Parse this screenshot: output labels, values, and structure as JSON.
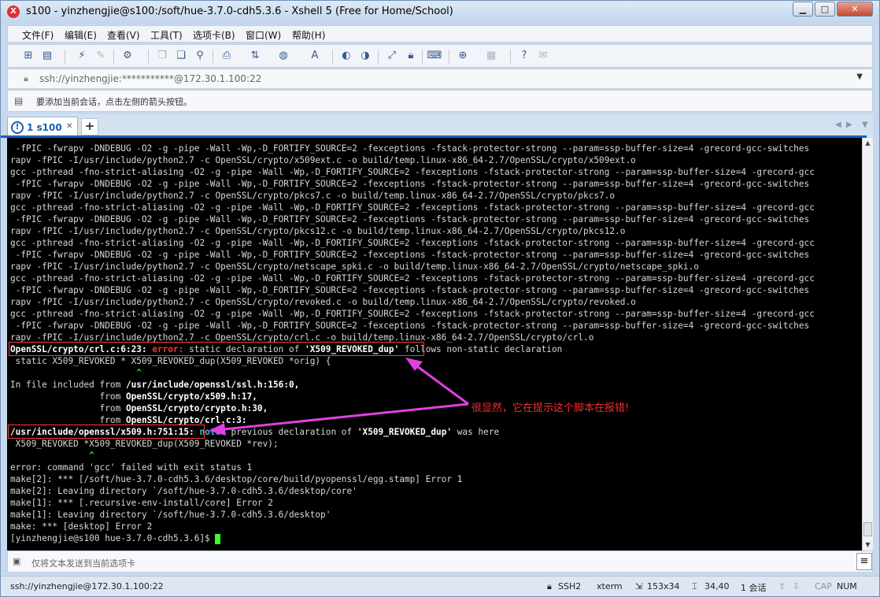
{
  "window": {
    "title": "s100 - yinzhengjie@s100:/soft/hue-3.7.0-cdh5.3.6 - Xshell 5 (Free for Home/School)",
    "app_icon": "xshell-icon",
    "minimize_icon": "minimize-icon",
    "maximize_icon": "maximize-icon",
    "close_icon": "close-icon"
  },
  "menu": [
    "文件(F)",
    "编辑(E)",
    "查看(V)",
    "工具(T)",
    "选项卡(B)",
    "窗口(W)",
    "帮助(H)"
  ],
  "toolbar_icons": [
    "new-session-icon",
    "open-folder-icon",
    "connect-icon",
    "disconnect-icon",
    "properties-icon",
    "copy-icon",
    "paste-icon",
    "find-icon",
    "print-icon",
    "transfer-icon",
    "globe-icon",
    "font-icon",
    "xftp-icon",
    "xmanager-icon",
    "fullscreen-icon",
    "lock-icon",
    "keyboard-icon",
    "compose-icon",
    "layout-icon",
    "help-icon",
    "chat-icon"
  ],
  "address": {
    "value": "ssh://yinzhengjie:***********@172.30.1.100:22"
  },
  "hint": {
    "text": "要添加当前会话，点击左侧的箭头按钮。"
  },
  "tabs": [
    {
      "label": "1 s100",
      "status": "alert-icon"
    }
  ],
  "tab_add": "+",
  "terminal": {
    "lines": [
      " -fPIC -fwrapv -DNDEBUG -O2 -g -pipe -Wall -Wp,-D_FORTIFY_SOURCE=2 -fexceptions -fstack-protector-strong --param=ssp-buffer-size=4 -grecord-gcc-switches",
      "rapv -fPIC -I/usr/include/python2.7 -c OpenSSL/crypto/x509ext.c -o build/temp.linux-x86_64-2.7/OpenSSL/crypto/x509ext.o",
      "gcc -pthread -fno-strict-aliasing -O2 -g -pipe -Wall -Wp,-D_FORTIFY_SOURCE=2 -fexceptions -fstack-protector-strong --param=ssp-buffer-size=4 -grecord-gcc",
      " -fPIC -fwrapv -DNDEBUG -O2 -g -pipe -Wall -Wp,-D_FORTIFY_SOURCE=2 -fexceptions -fstack-protector-strong --param=ssp-buffer-size=4 -grecord-gcc-switches",
      "rapv -fPIC -I/usr/include/python2.7 -c OpenSSL/crypto/pkcs7.c -o build/temp.linux-x86_64-2.7/OpenSSL/crypto/pkcs7.o",
      "gcc -pthread -fno-strict-aliasing -O2 -g -pipe -Wall -Wp,-D_FORTIFY_SOURCE=2 -fexceptions -fstack-protector-strong --param=ssp-buffer-size=4 -grecord-gcc",
      " -fPIC -fwrapv -DNDEBUG -O2 -g -pipe -Wall -Wp,-D_FORTIFY_SOURCE=2 -fexceptions -fstack-protector-strong --param=ssp-buffer-size=4 -grecord-gcc-switches",
      "rapv -fPIC -I/usr/include/python2.7 -c OpenSSL/crypto/pkcs12.c -o build/temp.linux-x86_64-2.7/OpenSSL/crypto/pkcs12.o",
      "gcc -pthread -fno-strict-aliasing -O2 -g -pipe -Wall -Wp,-D_FORTIFY_SOURCE=2 -fexceptions -fstack-protector-strong --param=ssp-buffer-size=4 -grecord-gcc",
      " -fPIC -fwrapv -DNDEBUG -O2 -g -pipe -Wall -Wp,-D_FORTIFY_SOURCE=2 -fexceptions -fstack-protector-strong --param=ssp-buffer-size=4 -grecord-gcc-switches",
      "rapv -fPIC -I/usr/include/python2.7 -c OpenSSL/crypto/netscape_spki.c -o build/temp.linux-x86_64-2.7/OpenSSL/crypto/netscape_spki.o",
      "gcc -pthread -fno-strict-aliasing -O2 -g -pipe -Wall -Wp,-D_FORTIFY_SOURCE=2 -fexceptions -fstack-protector-strong --param=ssp-buffer-size=4 -grecord-gcc",
      " -fPIC -fwrapv -DNDEBUG -O2 -g -pipe -Wall -Wp,-D_FORTIFY_SOURCE=2 -fexceptions -fstack-protector-strong --param=ssp-buffer-size=4 -grecord-gcc-switches",
      "rapv -fPIC -I/usr/include/python2.7 -c OpenSSL/crypto/revoked.c -o build/temp.linux-x86_64-2.7/OpenSSL/crypto/revoked.o",
      "gcc -pthread -fno-strict-aliasing -O2 -g -pipe -Wall -Wp,-D_FORTIFY_SOURCE=2 -fexceptions -fstack-protector-strong --param=ssp-buffer-size=4 -grecord-gcc",
      " -fPIC -fwrapv -DNDEBUG -O2 -g -pipe -Wall -Wp,-D_FORTIFY_SOURCE=2 -fexceptions -fstack-protector-strong --param=ssp-buffer-size=4 -grecord-gcc-switches",
      "rapv -fPIC -I/usr/include/python2.7 -c OpenSSL/crypto/crl.c -o build/temp.linux-x86_64-2.7/OpenSSL/crypto/crl.o"
    ],
    "err1_loc": "OpenSSL/crypto/crl.c:6:23:",
    "err1_kw": "error:",
    "err1_msg": "static declaration of ",
    "err1_name": "'X509_REVOKED_dup'",
    "err1_tail": " follows non-static declaration",
    "src1": " static X509_REVOKED * X509_REVOKED_dup(X509_REVOKED *orig) {",
    "caret1": "                        ^",
    "inc1_pre": "In file included from ",
    "inc1_file": "/usr/include/openssl/ssl.h:156:0,",
    "inc_from": "from ",
    "inc2_file": "OpenSSL/crypto/x509.h:17,",
    "inc3_file": "OpenSSL/crypto/crypto.h:30,",
    "inc4_file": "OpenSSL/crypto/crl.c:3:",
    "note_loc": "/usr/include/openssl/x509.h:751:15:",
    "note_kw": "note:",
    "note_msg": " previous declaration of ",
    "note_name": "'X509_REVOKED_dup'",
    "note_tail": " was here",
    "src2": " X509_REVOKED *X509_REVOKED_dup(X509_REVOKED *rev);",
    "caret2": "               ^",
    "tail_lines": [
      "error: command 'gcc' failed with exit status 1",
      "make[2]: *** [/soft/hue-3.7.0-cdh5.3.6/desktop/core/build/pyopenssl/egg.stamp] Error 1",
      "make[2]: Leaving directory `/soft/hue-3.7.0-cdh5.3.6/desktop/core'",
      "make[1]: *** [.recursive-env-install/core] Error 2",
      "make[1]: Leaving directory `/soft/hue-3.7.0-cdh5.3.6/desktop'",
      "make: *** [desktop] Error 2"
    ],
    "prompt": "[yinzhengjie@s100 hue-3.7.0-cdh5.3.6]$ "
  },
  "annotation": "很显然，它在提示这个脚本在报错!",
  "annotation_color": "#ff2a2a",
  "arrow_color": "#e040e0",
  "send_bar": {
    "placeholder": "仅将文本发送到当前选项卡",
    "menu_icon": "hamburger-menu-icon"
  },
  "status": {
    "address": "ssh://yinzhengjie@172.30.1.100:22",
    "protocol": "SSH2",
    "term": "xterm",
    "size": "153x34",
    "cursor": "34,40",
    "sessions": "1 会话",
    "cap": "CAP",
    "num": "NUM"
  }
}
